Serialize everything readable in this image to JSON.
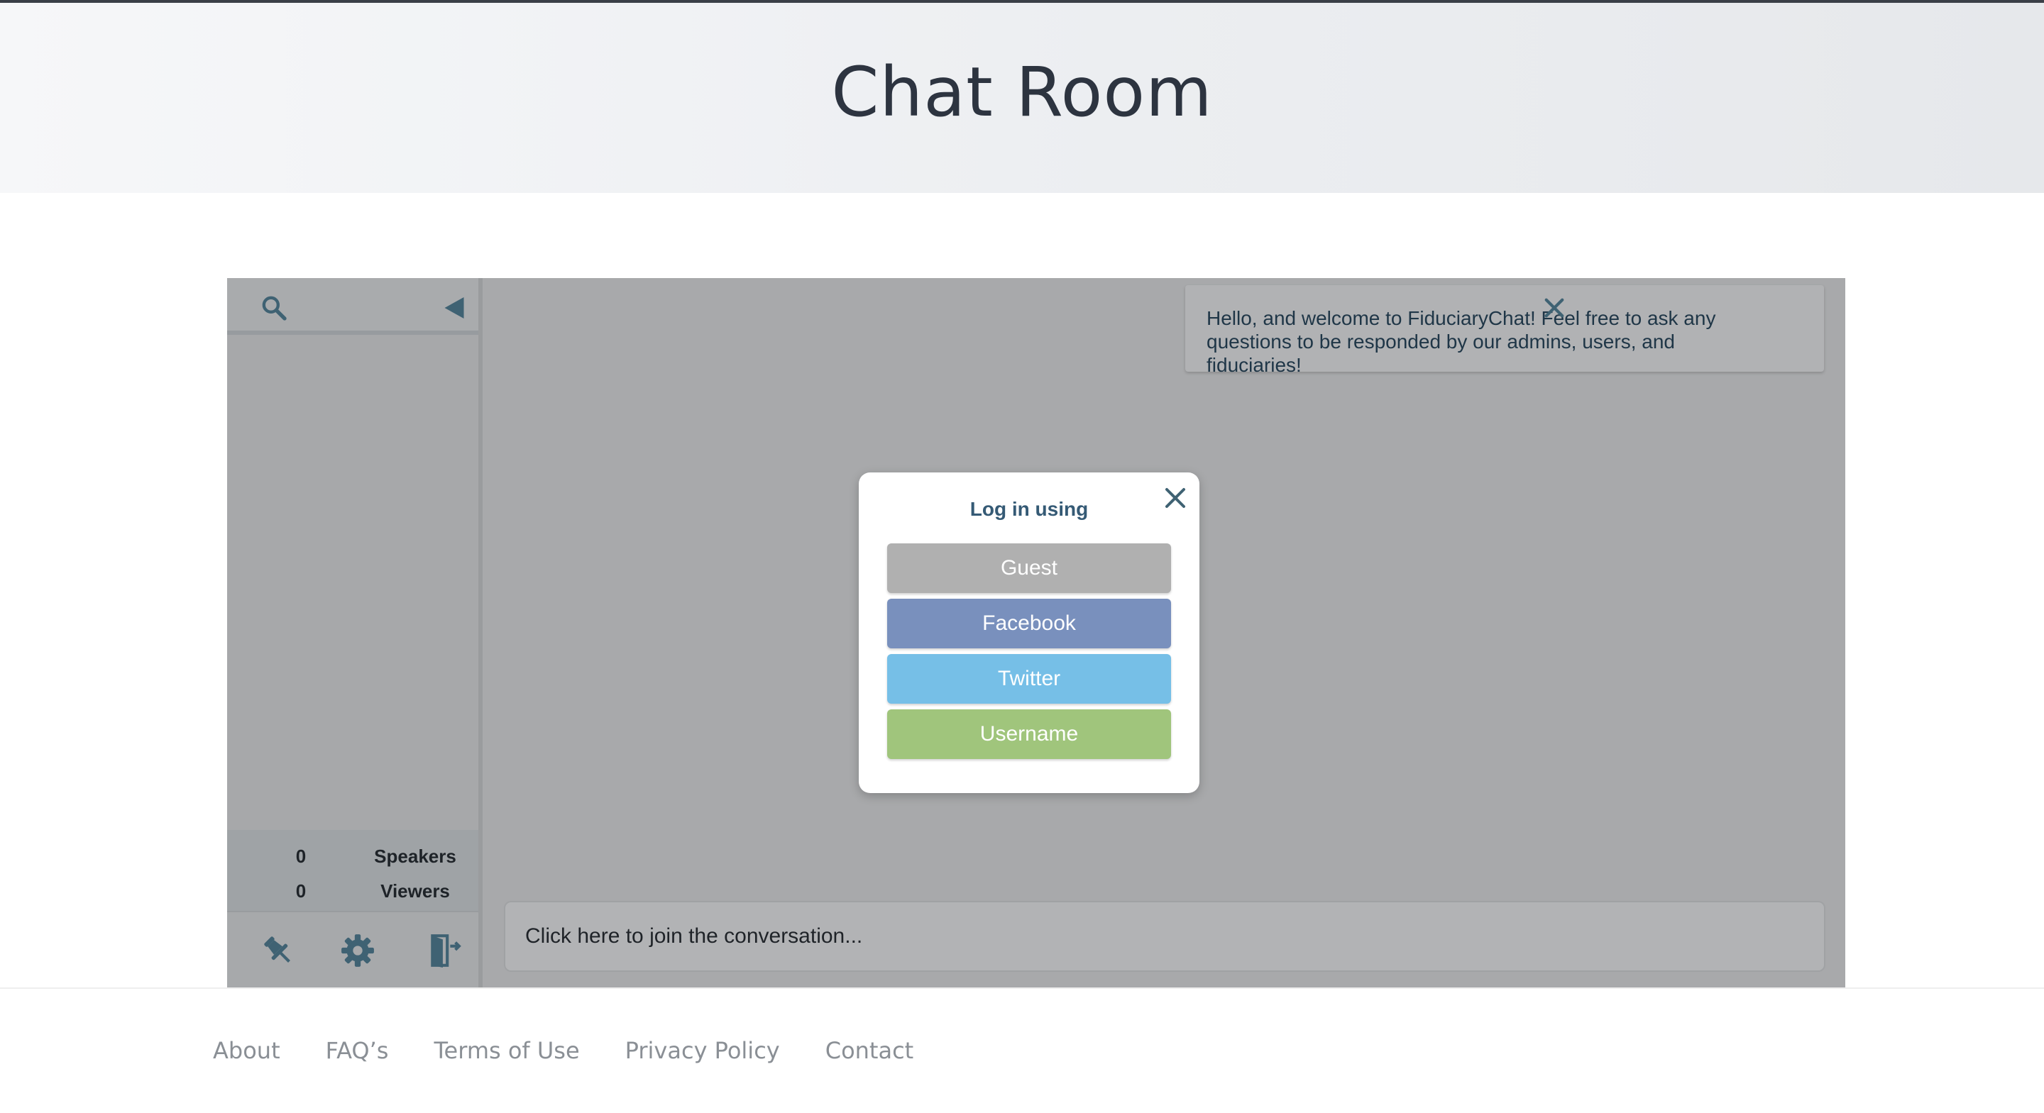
{
  "header": {
    "title": "Chat Room"
  },
  "sidebar": {
    "search_icon": "search-icon",
    "collapse_icon": "triangle-left-icon",
    "stats": [
      {
        "count": "0",
        "label": "Speakers"
      },
      {
        "count": "0",
        "label": "Viewers"
      }
    ],
    "tools": [
      "pushpin-icon",
      "gear-icon",
      "exit-door-icon"
    ]
  },
  "notice": {
    "text": "Hello, and welcome to FiduciaryChat! Feel free to ask any questions to be responded by our admins, users, and fiduciaries!",
    "close_icon": "close-icon"
  },
  "login_modal": {
    "title": "Log in using",
    "close_icon": "close-icon",
    "options": [
      {
        "label": "Guest",
        "color": "#b0b0b0"
      },
      {
        "label": "Facebook",
        "color": "#7990bd"
      },
      {
        "label": "Twitter",
        "color": "#76bfe7"
      },
      {
        "label": "Username",
        "color": "#a0c57c"
      }
    ]
  },
  "composer": {
    "placeholder": "Click here to join the conversation..."
  },
  "footer": {
    "links": [
      "About",
      "FAQ’s",
      "Terms of Use",
      "Privacy Policy",
      "Contact"
    ]
  },
  "colors": {
    "accent": "#3f6273",
    "title": "#2d3440",
    "overlay": "#a8a9ab"
  }
}
